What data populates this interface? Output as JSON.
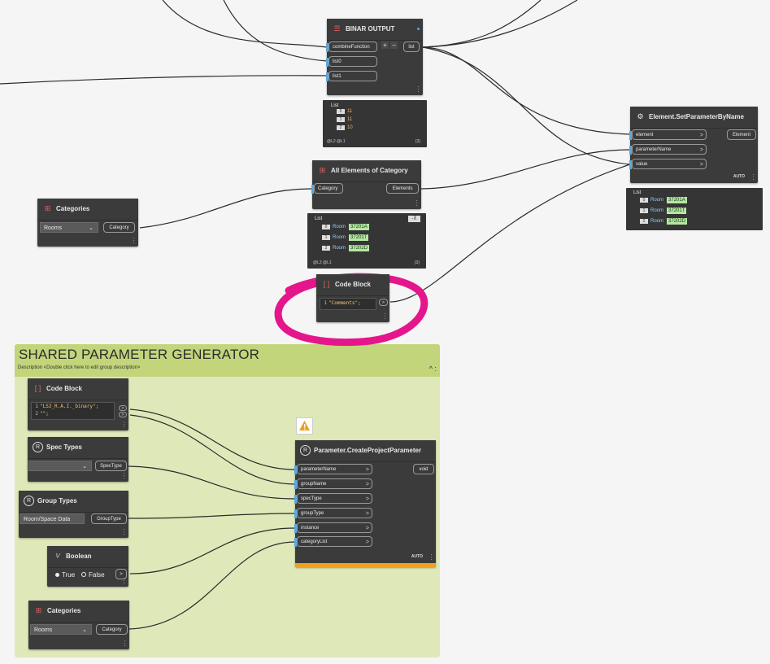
{
  "colors": {
    "group_bg": "#dfe8b8",
    "group_header": "#c2d57b",
    "node_bg": "#3b3b3b",
    "wire": "#2b2b2b",
    "port_accent": "#5aa7e0",
    "highlight": "#e5168c",
    "warning": "#f0a020",
    "value_green": "#b6e6a4"
  },
  "group": {
    "title": "SHARED PARAMETER GENERATOR",
    "description": "Description <Double click here to edit group description>",
    "controls": "^ :"
  },
  "nodes": {
    "binar_output": {
      "title": "BINAR OUTPUT",
      "icon": "list-combine-icon",
      "inputs": [
        "combineFunction",
        "list0",
        "list1"
      ],
      "output": "list",
      "plus": "+",
      "minus": "−"
    },
    "binar_preview": {
      "header": "List",
      "rows": [
        {
          "index": "0",
          "value": "11"
        },
        {
          "index": "1",
          "value": "11"
        },
        {
          "index": "2",
          "value": "10"
        }
      ],
      "footer_left": "@L2 @L1",
      "footer_right": "{3}"
    },
    "set_param": {
      "title": "Element.SetParameterByName",
      "icon": "gear-icon",
      "inputs": [
        "element",
        "parameterName",
        "value"
      ],
      "output": "Element",
      "lacing": "AUTO"
    },
    "set_param_preview": {
      "header": "List",
      "rows": [
        {
          "index": "0",
          "type": "Room",
          "value": "37201A"
        },
        {
          "index": "1",
          "type": "Room",
          "value": "37201T"
        },
        {
          "index": "2",
          "type": "Room",
          "value": "37202D"
        }
      ]
    },
    "all_elements": {
      "title": "All Elements of Category",
      "icon": "revit-icon",
      "input": "Category",
      "output": "Elements"
    },
    "all_elements_preview": {
      "header": "List",
      "rows": [
        {
          "index": "0",
          "type": "Room",
          "value": "37201A"
        },
        {
          "index": "1",
          "type": "Room",
          "value": "37201T"
        },
        {
          "index": "2",
          "type": "Room",
          "value": "37202D"
        }
      ],
      "footer_left": "@L2 @L1",
      "footer_right": "{3}",
      "pin": "-⊼"
    },
    "categories_top": {
      "title": "Categories",
      "icon": "revit-icon",
      "selected": "Rooms",
      "output": "Category"
    },
    "code_block_top": {
      "title": "Code Block",
      "icon": "code-block-icon",
      "lines": [
        {
          "n": "1",
          "code": "\"Comments\";"
        }
      ],
      "output": ">"
    },
    "code_block_group": {
      "title": "Code Block",
      "icon": "code-block-icon",
      "lines": [
        {
          "n": "1",
          "code": "\"LS2_R.A.I._binary\";"
        },
        {
          "n": "2",
          "code": "\"\";"
        }
      ],
      "outputs": [
        ">",
        ">"
      ]
    },
    "spec_types": {
      "title": "Spec Types",
      "icon": "revit-circle-icon",
      "selected": "",
      "output": "SpecType"
    },
    "group_types": {
      "title": "Group Types",
      "icon": "revit-circle-icon",
      "selected": "Room/Space Data",
      "output": "GroupType"
    },
    "boolean": {
      "title": "Boolean",
      "icon": "boolean-icon",
      "true_label": "True",
      "false_label": "False",
      "selected": "True",
      "output": ">"
    },
    "categories_group": {
      "title": "Categories",
      "icon": "revit-icon",
      "selected": "Rooms",
      "output": "Category"
    },
    "create_param": {
      "title": "Parameter.CreateProjectParameter",
      "icon": "revit-circle-icon",
      "inputs": [
        "parameterName",
        "groupName",
        "specType",
        "groupType",
        "instance",
        "categoryList"
      ],
      "output": "void",
      "lacing": "AUTO",
      "warning_icon": "warning-icon"
    }
  }
}
